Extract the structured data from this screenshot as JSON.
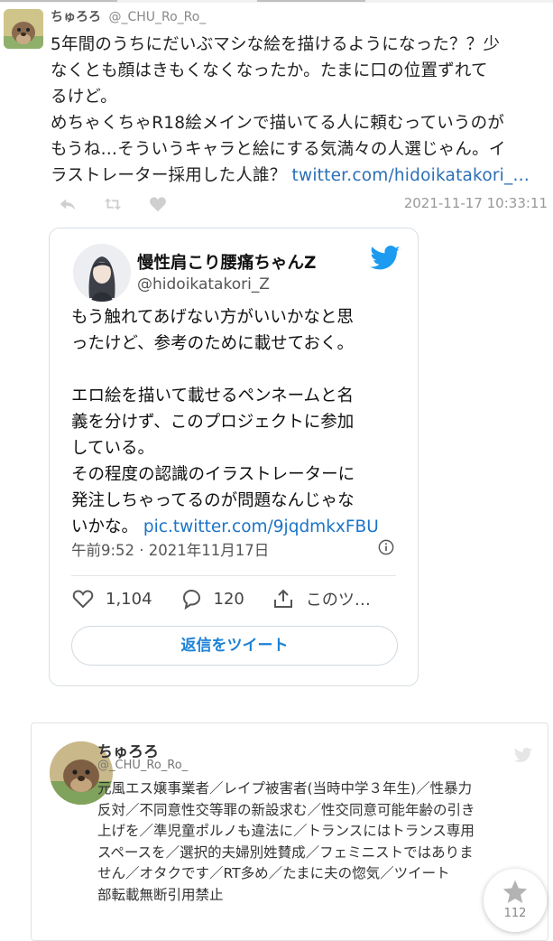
{
  "tweet": {
    "display_name": "ちゅろろ",
    "handle": "@_CHU_Ro_Ro_",
    "lines": [
      "5年間のうちにだいぶマシな絵を描けるようになった？？少",
      "なくとも顔はきもくなくなったか。たまに口の位置ずれて",
      "るけど。",
      "めちゃくちゃR18絵メインで描いてる人に頼むっていうのが",
      "もうね…そういうキャラと絵にする気満々の人選じゃん。イ",
      "ラストレーター採用した人誰？"
    ],
    "link": "twitter.com/hidoikatakori_…",
    "timestamp": "2021-11-17 10:33:11",
    "actions": [
      "reply-icon",
      "retweet-icon",
      "like-icon"
    ]
  },
  "embed": {
    "display_name": "慢性肩こり腰痛ちゃんZ",
    "handle": "@hidoikatakori_Z",
    "lines": [
      "もう触れてあげない方がいいかなと思",
      "ったけど、参考のために載せておく。",
      "",
      "エロ絵を描いて載せるペンネームと名",
      "義を分けず、このプロジェクトに参加",
      "している。",
      "その程度の認識のイラストレーターに",
      "発注しちゃってるのが問題なんじゃな",
      "いかな。"
    ],
    "link": "pic.twitter.com/9jqdmkxFBU",
    "date": "午前9:52 · 2021年11月17日",
    "likes": "1,104",
    "replies": "120",
    "share_label": "このツ…",
    "reply_button": "返信をツイート",
    "accent": "#1d9bf0"
  },
  "profile": {
    "display_name": "ちゅろろ",
    "handle": "@_CHU_Ro_Ro_",
    "bio_lines": [
      "元風エス嬢事業者／レイプ被害者(当時中学３年生)／性暴力",
      "反対／不同意性交等罪の新設求む／性交同意可能年齢の引き",
      "上げを／準児童ポルノも違法に／トランスにはトランス専用",
      "スペースを／選択的夫婦別姓賛成／フェミニストではありま",
      "せん／オタクです／RT多め／たまに夫の惚気／ツイート",
      "部転載無断引用禁止"
    ]
  },
  "favorite": {
    "icon": "star-icon",
    "count": "112"
  }
}
